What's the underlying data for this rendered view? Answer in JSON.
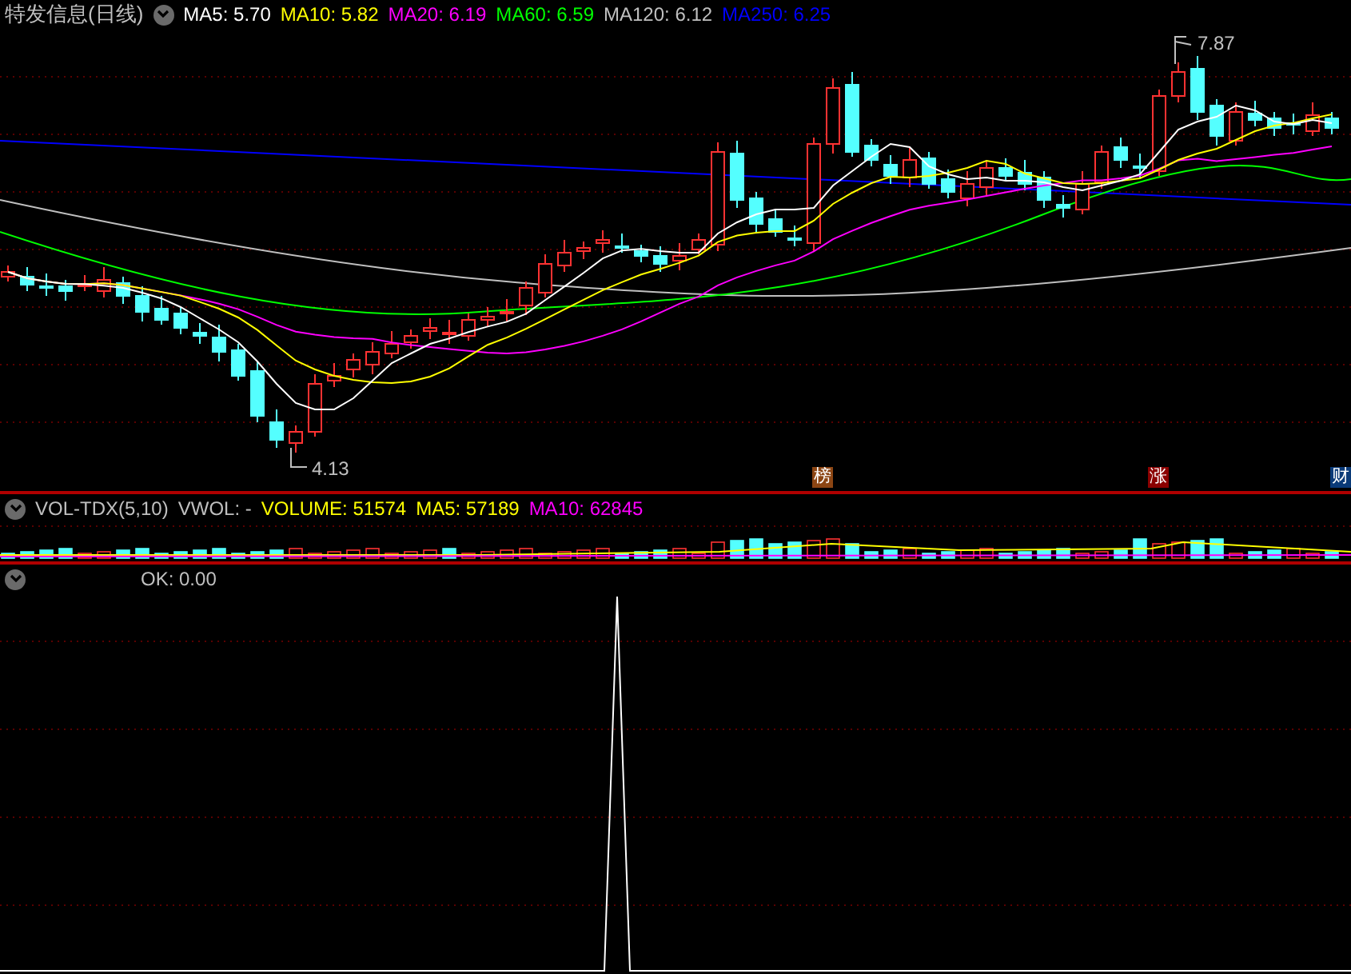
{
  "main_panel": {
    "title": "特发信息(日线)",
    "indicators": [
      {
        "label": "MA5: 5.70",
        "color": "#ffffff"
      },
      {
        "label": "MA10: 5.82",
        "color": "#ffff00"
      },
      {
        "label": "MA20: 6.19",
        "color": "#ff00ff"
      },
      {
        "label": "MA60: 6.59",
        "color": "#00ff00"
      },
      {
        "label": "MA120: 6.12",
        "color": "#c0c0c0"
      },
      {
        "label": "MA250: 6.25",
        "color": "#0000ff"
      }
    ],
    "high_label": "7.87",
    "low_label": "4.13",
    "badges": [
      {
        "text": "榜",
        "color": "#8b4513"
      },
      {
        "text": "涨",
        "color": "#8b0000"
      },
      {
        "text": "财",
        "color": "#0a3a78"
      }
    ]
  },
  "volume_panel": {
    "indicators": [
      {
        "label": "VOL-TDX(5,10)",
        "color": "#c0c0c0"
      },
      {
        "label": "VWOL: -",
        "color": "#c0c0c0"
      },
      {
        "label": "VOLUME: 51574",
        "color": "#ffff00"
      },
      {
        "label": "MA5: 57189",
        "color": "#ffff00"
      },
      {
        "label": "MA10: 62845",
        "color": "#ff00ff"
      }
    ]
  },
  "ok_panel": {
    "indicators": [
      {
        "label": "OK: 0.00",
        "color": "#c0c0c0"
      }
    ]
  }
}
